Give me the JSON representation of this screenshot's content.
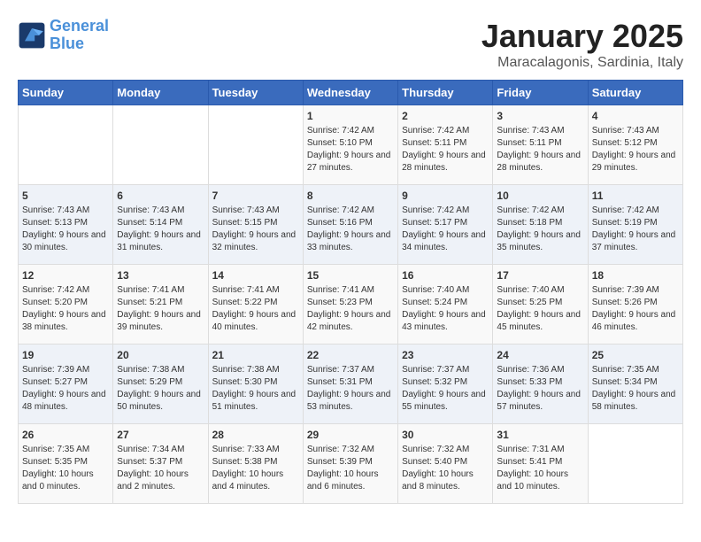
{
  "logo": {
    "line1": "General",
    "line2": "Blue"
  },
  "title": "January 2025",
  "location": "Maracalagonis, Sardinia, Italy",
  "headers": [
    "Sunday",
    "Monday",
    "Tuesday",
    "Wednesday",
    "Thursday",
    "Friday",
    "Saturday"
  ],
  "weeks": [
    [
      {
        "day": "",
        "text": ""
      },
      {
        "day": "",
        "text": ""
      },
      {
        "day": "",
        "text": ""
      },
      {
        "day": "1",
        "text": "Sunrise: 7:42 AM\nSunset: 5:10 PM\nDaylight: 9 hours and 27 minutes."
      },
      {
        "day": "2",
        "text": "Sunrise: 7:42 AM\nSunset: 5:11 PM\nDaylight: 9 hours and 28 minutes."
      },
      {
        "day": "3",
        "text": "Sunrise: 7:43 AM\nSunset: 5:11 PM\nDaylight: 9 hours and 28 minutes."
      },
      {
        "day": "4",
        "text": "Sunrise: 7:43 AM\nSunset: 5:12 PM\nDaylight: 9 hours and 29 minutes."
      }
    ],
    [
      {
        "day": "5",
        "text": "Sunrise: 7:43 AM\nSunset: 5:13 PM\nDaylight: 9 hours and 30 minutes."
      },
      {
        "day": "6",
        "text": "Sunrise: 7:43 AM\nSunset: 5:14 PM\nDaylight: 9 hours and 31 minutes."
      },
      {
        "day": "7",
        "text": "Sunrise: 7:43 AM\nSunset: 5:15 PM\nDaylight: 9 hours and 32 minutes."
      },
      {
        "day": "8",
        "text": "Sunrise: 7:42 AM\nSunset: 5:16 PM\nDaylight: 9 hours and 33 minutes."
      },
      {
        "day": "9",
        "text": "Sunrise: 7:42 AM\nSunset: 5:17 PM\nDaylight: 9 hours and 34 minutes."
      },
      {
        "day": "10",
        "text": "Sunrise: 7:42 AM\nSunset: 5:18 PM\nDaylight: 9 hours and 35 minutes."
      },
      {
        "day": "11",
        "text": "Sunrise: 7:42 AM\nSunset: 5:19 PM\nDaylight: 9 hours and 37 minutes."
      }
    ],
    [
      {
        "day": "12",
        "text": "Sunrise: 7:42 AM\nSunset: 5:20 PM\nDaylight: 9 hours and 38 minutes."
      },
      {
        "day": "13",
        "text": "Sunrise: 7:41 AM\nSunset: 5:21 PM\nDaylight: 9 hours and 39 minutes."
      },
      {
        "day": "14",
        "text": "Sunrise: 7:41 AM\nSunset: 5:22 PM\nDaylight: 9 hours and 40 minutes."
      },
      {
        "day": "15",
        "text": "Sunrise: 7:41 AM\nSunset: 5:23 PM\nDaylight: 9 hours and 42 minutes."
      },
      {
        "day": "16",
        "text": "Sunrise: 7:40 AM\nSunset: 5:24 PM\nDaylight: 9 hours and 43 minutes."
      },
      {
        "day": "17",
        "text": "Sunrise: 7:40 AM\nSunset: 5:25 PM\nDaylight: 9 hours and 45 minutes."
      },
      {
        "day": "18",
        "text": "Sunrise: 7:39 AM\nSunset: 5:26 PM\nDaylight: 9 hours and 46 minutes."
      }
    ],
    [
      {
        "day": "19",
        "text": "Sunrise: 7:39 AM\nSunset: 5:27 PM\nDaylight: 9 hours and 48 minutes."
      },
      {
        "day": "20",
        "text": "Sunrise: 7:38 AM\nSunset: 5:29 PM\nDaylight: 9 hours and 50 minutes."
      },
      {
        "day": "21",
        "text": "Sunrise: 7:38 AM\nSunset: 5:30 PM\nDaylight: 9 hours and 51 minutes."
      },
      {
        "day": "22",
        "text": "Sunrise: 7:37 AM\nSunset: 5:31 PM\nDaylight: 9 hours and 53 minutes."
      },
      {
        "day": "23",
        "text": "Sunrise: 7:37 AM\nSunset: 5:32 PM\nDaylight: 9 hours and 55 minutes."
      },
      {
        "day": "24",
        "text": "Sunrise: 7:36 AM\nSunset: 5:33 PM\nDaylight: 9 hours and 57 minutes."
      },
      {
        "day": "25",
        "text": "Sunrise: 7:35 AM\nSunset: 5:34 PM\nDaylight: 9 hours and 58 minutes."
      }
    ],
    [
      {
        "day": "26",
        "text": "Sunrise: 7:35 AM\nSunset: 5:35 PM\nDaylight: 10 hours and 0 minutes."
      },
      {
        "day": "27",
        "text": "Sunrise: 7:34 AM\nSunset: 5:37 PM\nDaylight: 10 hours and 2 minutes."
      },
      {
        "day": "28",
        "text": "Sunrise: 7:33 AM\nSunset: 5:38 PM\nDaylight: 10 hours and 4 minutes."
      },
      {
        "day": "29",
        "text": "Sunrise: 7:32 AM\nSunset: 5:39 PM\nDaylight: 10 hours and 6 minutes."
      },
      {
        "day": "30",
        "text": "Sunrise: 7:32 AM\nSunset: 5:40 PM\nDaylight: 10 hours and 8 minutes."
      },
      {
        "day": "31",
        "text": "Sunrise: 7:31 AM\nSunset: 5:41 PM\nDaylight: 10 hours and 10 minutes."
      },
      {
        "day": "",
        "text": ""
      }
    ]
  ]
}
